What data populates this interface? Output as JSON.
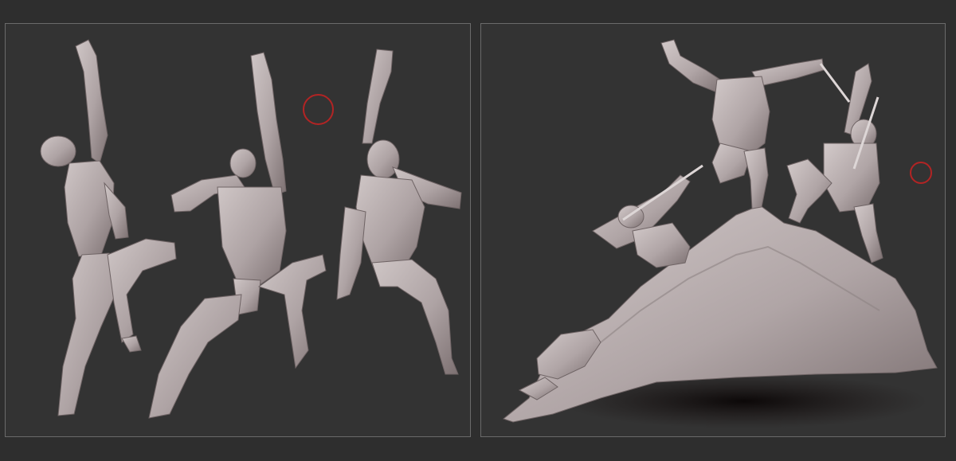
{
  "app": {
    "type": "3d-sculpting-viewport-comparison"
  },
  "colors": {
    "background": "#2e2e2e",
    "viewport_border": "#6a6a6a",
    "clay": "#aea3a4",
    "clay_shadow": "#7d7172",
    "clay_highlight": "#cfc6c6",
    "brush_cursor": "#b22424"
  },
  "viewports": [
    {
      "name": "left-viewport",
      "content": "three-sculpted-figures",
      "brush_cursor_icon": "brush-circle-icon"
    },
    {
      "name": "right-viewport",
      "content": "sculpted-figures-on-rock-base",
      "brush_cursor_icon": "brush-circle-icon"
    }
  ]
}
